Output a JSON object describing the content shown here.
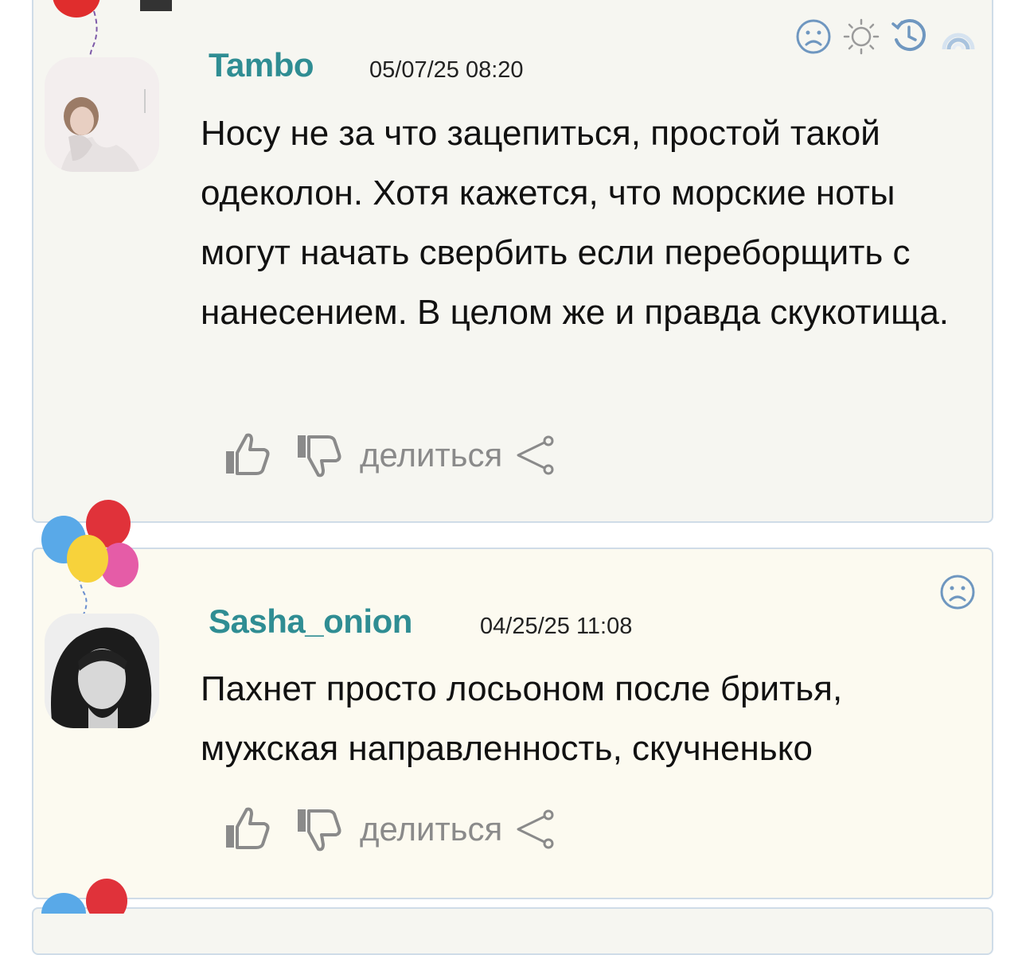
{
  "comments": [
    {
      "username": "Tambo",
      "timestamp": "05/07/25 08:20",
      "text": "Носу не за что зацепиться, простой такой одеколон. Хотя кажется, что морские ноты могут начать свербить если переборщить с нанесением. В целом же и правда скукотища.",
      "share_label": "делиться",
      "top_icons": [
        "sad-face-icon",
        "sun-icon",
        "clock-history-icon",
        "rainbow-icon"
      ]
    },
    {
      "username": "Sasha_onion",
      "timestamp": "04/25/25 11:08",
      "text": "Пахнет просто лосьоном после бритья, мужская направленность, скучненько",
      "share_label": "делиться",
      "top_icons": [
        "sad-face-icon"
      ]
    }
  ],
  "colors": {
    "username": "#2f8d93",
    "icon_blue": "#6f97c0",
    "action_gray": "#8a8a8a",
    "card_border": "#cfdce8"
  }
}
